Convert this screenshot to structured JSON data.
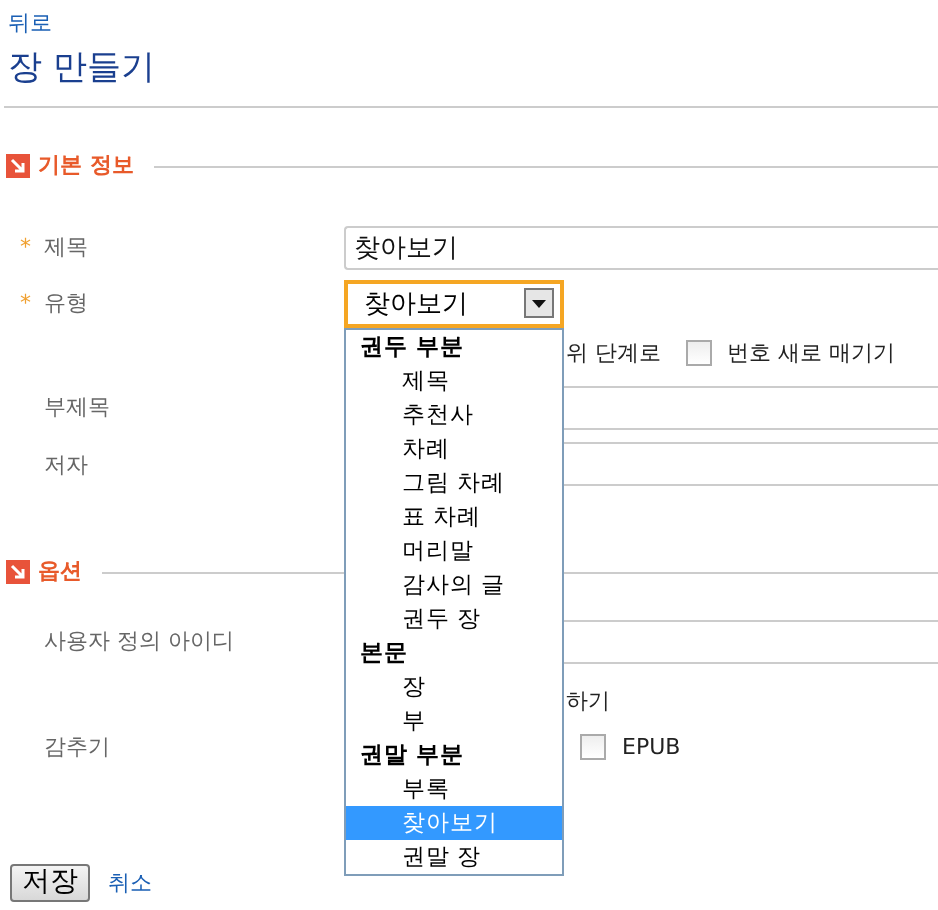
{
  "back_link": "뒤로",
  "page_title": "장 만들기",
  "sections": [
    {
      "title": "기본 정보",
      "fields": [
        {
          "kind": "text",
          "required_mark": "*",
          "label": "제목",
          "value": "찾아보기"
        },
        {
          "kind": "select",
          "required_mark": "*",
          "label": "유형",
          "value": "찾아보기",
          "focused": true,
          "open": true
        },
        {
          "kind": "checks",
          "note": "위 단계로",
          "items": [
            {
              "label": "번호 새로 매기기",
              "checked": false
            }
          ]
        },
        {
          "kind": "text",
          "label": "부제목"
        },
        {
          "kind": "text",
          "label": "저자"
        }
      ]
    },
    {
      "title": "옵션",
      "fields": [
        {
          "kind": "text",
          "label": "사용자 정의 아이디"
        },
        {
          "kind": "checks",
          "note": "하기"
        },
        {
          "kind": "checks",
          "label": "감추기",
          "items": [
            {
              "label": "EPUB",
              "checked": false
            }
          ]
        }
      ]
    }
  ],
  "dropdown": {
    "groups": [
      {
        "label": "권두 부분",
        "options": [
          {
            "label": "제목",
            "selected": false
          },
          {
            "label": "추천사",
            "selected": false
          },
          {
            "label": "차례",
            "selected": false
          },
          {
            "label": "그림 차례",
            "selected": false
          },
          {
            "label": "표 차례",
            "selected": false
          },
          {
            "label": "머리말",
            "selected": false
          },
          {
            "label": "감사의 글",
            "selected": false
          },
          {
            "label": "권두 장",
            "selected": false
          }
        ]
      },
      {
        "label": "본문",
        "options": [
          {
            "label": "장",
            "selected": false
          },
          {
            "label": "부",
            "selected": false
          }
        ]
      },
      {
        "label": "권말 부분",
        "options": [
          {
            "label": "부록",
            "selected": false
          },
          {
            "label": "찾아보기",
            "selected": true
          },
          {
            "label": "권말 장",
            "selected": false
          }
        ]
      }
    ]
  },
  "buttons": {
    "save": "저장",
    "cancel": "취소"
  }
}
